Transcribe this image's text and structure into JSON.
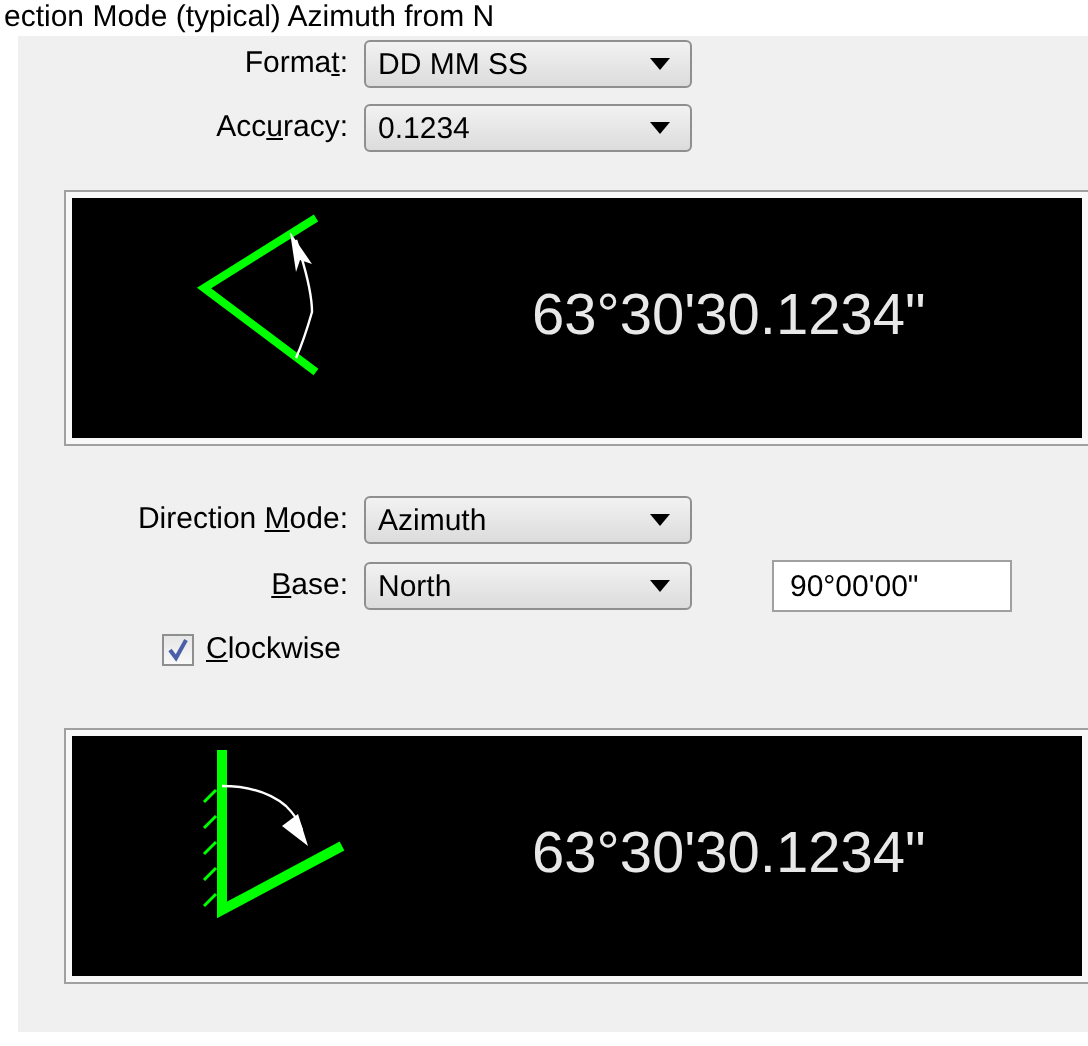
{
  "heading": "ection Mode (typical) Azimuth from N",
  "format_fields": [
    {
      "label": {
        "before": "Forma",
        "key": "t",
        "after": ":"
      },
      "value": "DD MM SS"
    },
    {
      "label": {
        "before": "Acc",
        "key": "u",
        "after": "racy:"
      },
      "value": "0.1234"
    }
  ],
  "preview_1": {
    "kind": "angle",
    "reading": "63°30'30.1234\""
  },
  "direction_mode": {
    "label": {
      "before": "Direction ",
      "key": "M",
      "after": "ode:"
    },
    "value": "Azimuth"
  },
  "base": {
    "label": {
      "key": "B",
      "after": "ase:"
    },
    "value": "North",
    "angle": "90°00'00\""
  },
  "clockwise": {
    "label": {
      "key": "C",
      "after": "lockwise"
    },
    "checked": true
  },
  "preview_2": {
    "kind": "azimuth",
    "reading": "63°30'30.1234\""
  }
}
